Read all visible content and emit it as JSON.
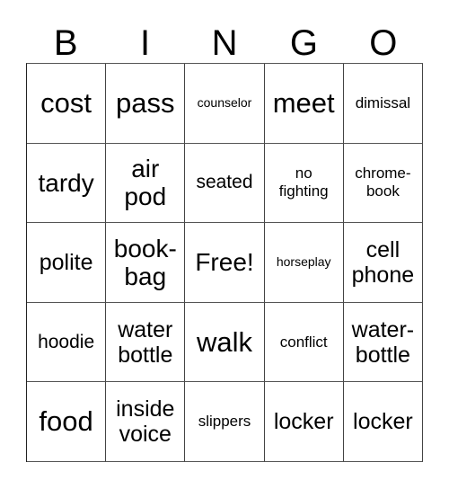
{
  "card": {
    "title": "BINGO",
    "header_letters": [
      "B",
      "I",
      "N",
      "G",
      "O"
    ],
    "free_space_label": "Free!",
    "colors": {
      "background": "#ffffff",
      "text": "#000000",
      "grid_line": "#444444"
    },
    "grid": {
      "columns": 5,
      "rows": 5,
      "cells": [
        [
          {
            "text": "cost",
            "size": "fs-xl"
          },
          {
            "text": "pass",
            "size": "fs-xl"
          },
          {
            "text": "counselor",
            "size": "fs-xxs"
          },
          {
            "text": "meet",
            "size": "fs-xl"
          },
          {
            "text": "dimissal",
            "size": "fs-xs"
          }
        ],
        [
          {
            "text": "tardy",
            "size": "fs-lg"
          },
          {
            "text": "air\npod",
            "size": "fs-lg"
          },
          {
            "text": "seated",
            "size": "fs-sm"
          },
          {
            "text": "no\nfighting",
            "size": "fs-xs"
          },
          {
            "text": "chrome-\nbook",
            "size": "fs-xs"
          }
        ],
        [
          {
            "text": "polite",
            "size": "fs-md"
          },
          {
            "text": "book-\nbag",
            "size": "fs-lg"
          },
          {
            "text": "Free!",
            "size": "fs-lg"
          },
          {
            "text": "horseplay",
            "size": "fs-xxs"
          },
          {
            "text": "cell\nphone",
            "size": "fs-md"
          }
        ],
        [
          {
            "text": "hoodie",
            "size": "fs-sm"
          },
          {
            "text": "water\nbottle",
            "size": "fs-md"
          },
          {
            "text": "walk",
            "size": "fs-xl"
          },
          {
            "text": "conflict",
            "size": "fs-xs"
          },
          {
            "text": "water-\nbottle",
            "size": "fs-md"
          }
        ],
        [
          {
            "text": "food",
            "size": "fs-xl"
          },
          {
            "text": "inside\nvoice",
            "size": "fs-md"
          },
          {
            "text": "slippers",
            "size": "fs-xs"
          },
          {
            "text": "locker",
            "size": "fs-md"
          },
          {
            "text": "locker",
            "size": "fs-md"
          }
        ]
      ]
    }
  }
}
